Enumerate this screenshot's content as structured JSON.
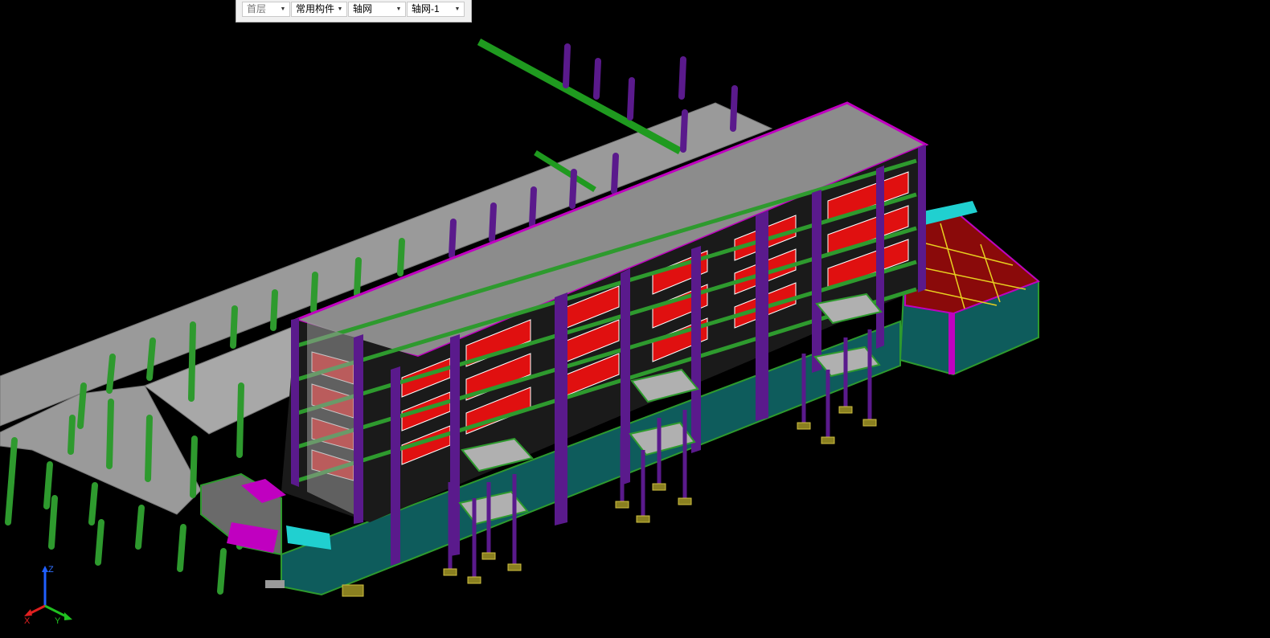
{
  "toolbar": {
    "floor": {
      "value": "首层",
      "arrow_icon": "chevron-down-icon"
    },
    "component_category": {
      "value": "常用构件",
      "arrow_icon": "chevron-down-icon"
    },
    "component_type": {
      "value": "轴网",
      "arrow_icon": "chevron-down-icon"
    },
    "component_instance": {
      "value": "轴网-1",
      "arrow_icon": "chevron-down-icon"
    }
  },
  "viewport": {
    "background": "#000000",
    "colors": {
      "slab": "#9a9a9a",
      "beam": "#2e9a2e",
      "column": "#5a1a8c",
      "room_fill": "#e01010",
      "wall": "#0e5c5c",
      "highlight": "#c000c0",
      "cyan": "#20d0d0",
      "footing": "#8a8020"
    }
  },
  "axis_gizmo": {
    "z": "Z",
    "x": "X",
    "y": "Y"
  }
}
